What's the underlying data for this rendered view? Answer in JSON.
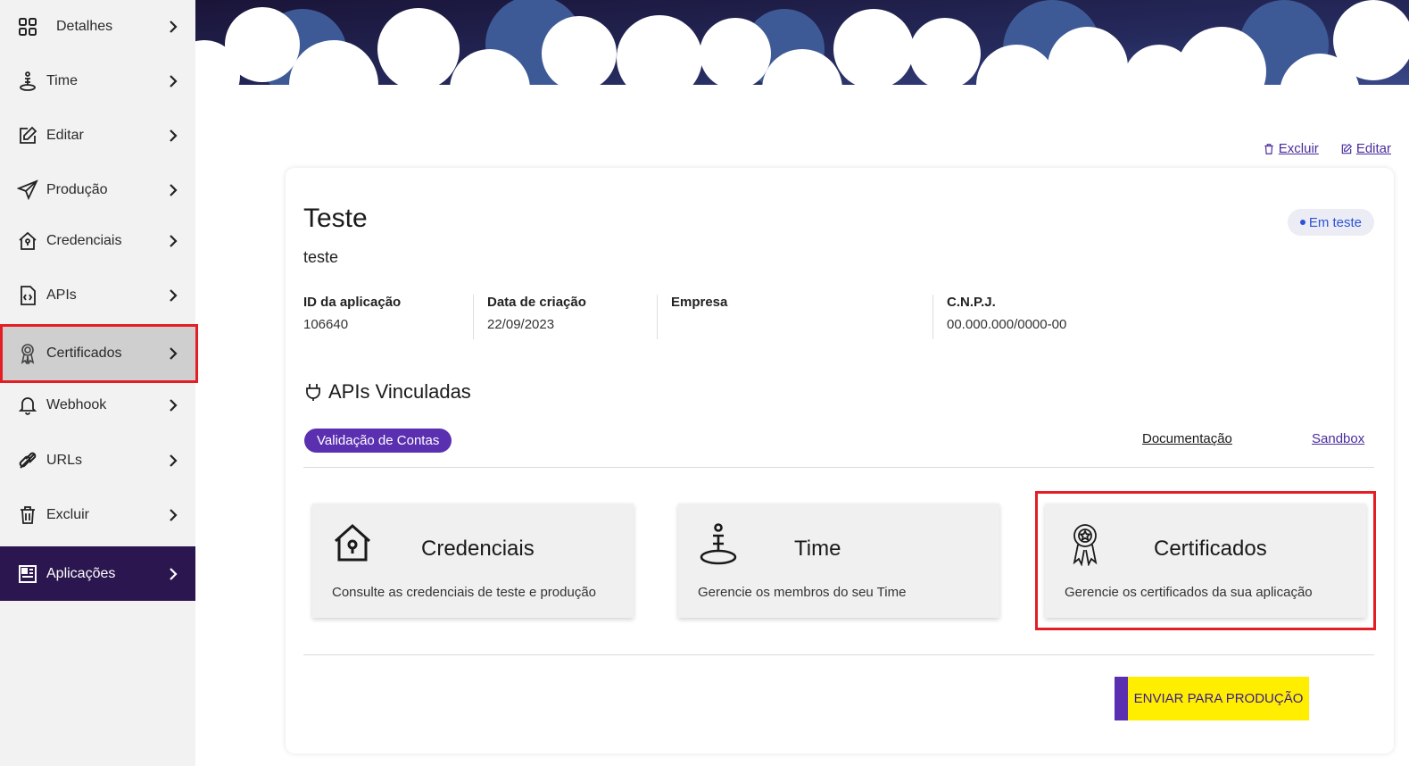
{
  "sidebar": {
    "items": [
      {
        "label": "Detalhes",
        "icon": "grid-icon"
      },
      {
        "label": "Time",
        "icon": "team-icon"
      },
      {
        "label": "Editar",
        "icon": "edit-icon"
      },
      {
        "label": "Produção",
        "icon": "send-icon"
      },
      {
        "label": "Credenciais",
        "icon": "house-lock-icon"
      },
      {
        "label": "APIs",
        "icon": "code-file-icon"
      },
      {
        "label": "Certificados",
        "icon": "award-icon"
      },
      {
        "label": "Webhook",
        "icon": "bell-icon"
      },
      {
        "label": "URLs",
        "icon": "link-icon"
      },
      {
        "label": "Excluir",
        "icon": "trash-icon"
      },
      {
        "label": "Aplicações",
        "icon": "dashboard-icon"
      }
    ]
  },
  "actions": {
    "delete_label": "Excluir",
    "edit_label": "Editar"
  },
  "app": {
    "title": "Teste",
    "description": "teste",
    "status": "Em teste",
    "info": [
      {
        "key": "ID da aplicação",
        "value": "106640"
      },
      {
        "key": "Data de criação",
        "value": "22/09/2023"
      },
      {
        "key": "Empresa",
        "value": ""
      },
      {
        "key": "C.N.P.J.",
        "value": "00.000.000/0000-00"
      }
    ]
  },
  "apis": {
    "title": "APIs Vinculadas",
    "linked": "Validação de Contas",
    "doc_link": "Documentação",
    "sandbox_link": "Sandbox"
  },
  "tiles": [
    {
      "title": "Credenciais",
      "desc": "Consulte as credenciais de teste e produção",
      "icon": "house-lock-icon"
    },
    {
      "title": "Time",
      "desc": "Gerencie os membros do seu Time",
      "icon": "team-icon"
    },
    {
      "title": "Certificados",
      "desc": "Gerencie os certificados da sua aplicação",
      "icon": "award-icon"
    }
  ],
  "footer": {
    "send_label": "ENVIAR PARA PRODUÇÃO"
  },
  "colors": {
    "brand_purple": "#5a2fb0",
    "dark_purple": "#2b1650",
    "highlight_red": "#e31e24",
    "cta_yellow": "#ffee00"
  }
}
